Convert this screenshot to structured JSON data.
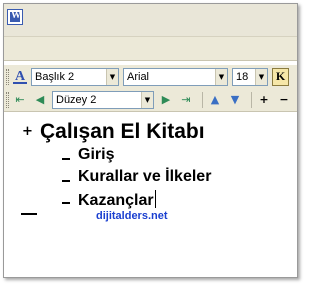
{
  "toolbar1": {
    "style_combo": "Başlık 2",
    "font_combo": "Arial",
    "size_combo": "18",
    "bold_label": "K"
  },
  "toolbar2": {
    "level_combo": "Düzey 2",
    "buttons": [
      "promote-heading",
      "promote",
      "demote",
      "demote-to-body",
      "move-up",
      "move-down",
      "expand",
      "collapse"
    ]
  },
  "document": {
    "heading1": "Çalışan El Kitabı",
    "items": [
      "Giriş",
      "Kurallar ve İlkeler",
      "Kazançlar"
    ],
    "watermark": "dijitalders.net"
  },
  "colors": {
    "chrome": "#ece9d8",
    "watermark": "#1a3fd0",
    "heading_text": "#000000"
  }
}
